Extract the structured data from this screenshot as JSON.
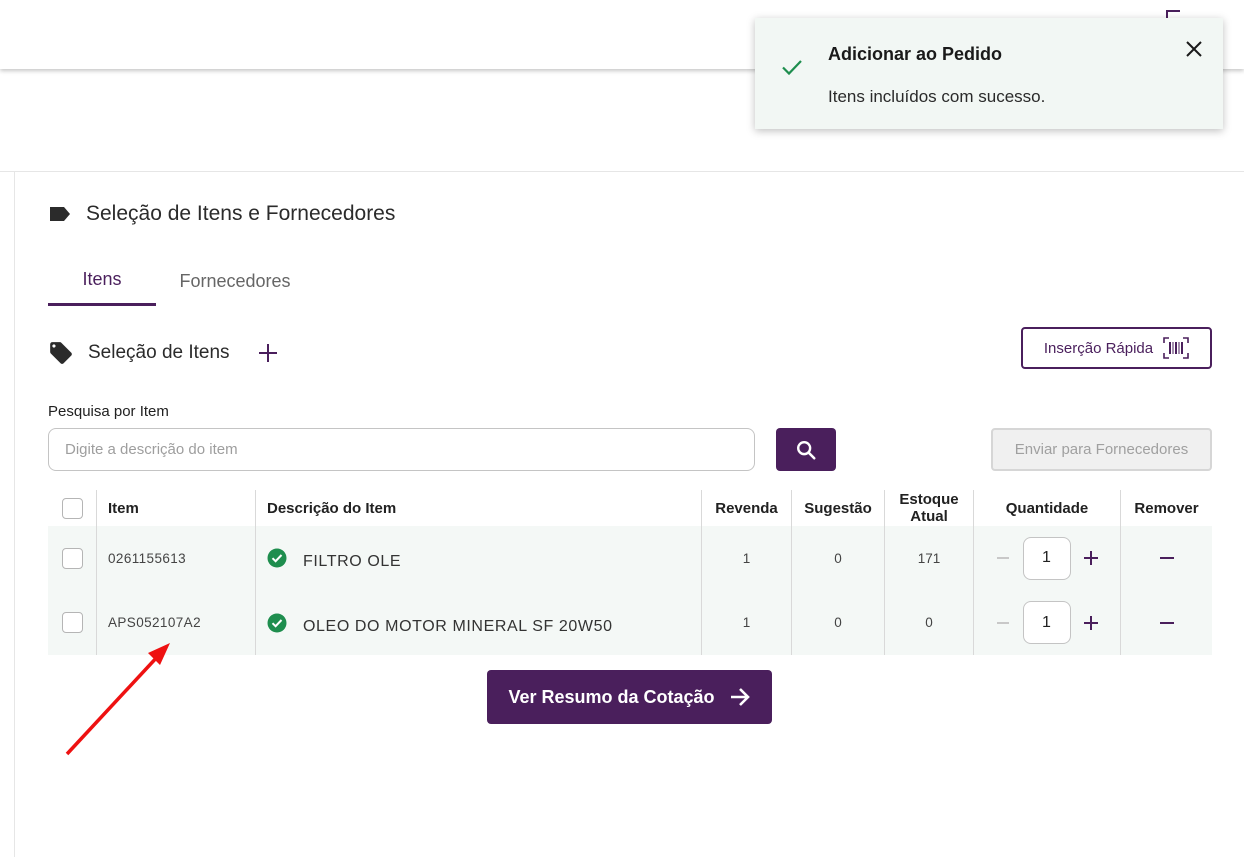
{
  "toast": {
    "title": "Adicionar ao Pedido",
    "message": "Itens incluídos com sucesso."
  },
  "section": {
    "title": "Seleção de Itens e Fornecedores"
  },
  "tabs": [
    {
      "label": "Itens",
      "active": true
    },
    {
      "label": "Fornecedores",
      "active": false
    }
  ],
  "items_section": {
    "title": "Seleção de Itens",
    "quick_insert_label": "Inserção Rápida"
  },
  "search": {
    "label": "Pesquisa por Item",
    "placeholder": "Digite a descrição do item",
    "value": ""
  },
  "send_button_label": "Enviar para Fornecedores",
  "table": {
    "headers": {
      "item": "Item",
      "description": "Descrição do Item",
      "resale": "Revenda",
      "suggestion": "Sugestão",
      "stock": "Estoque Atual",
      "quantity": "Quantidade",
      "remove": "Remover"
    },
    "rows": [
      {
        "code": "0261155613",
        "description": "FILTRO OLE",
        "resale": "1",
        "suggestion": "0",
        "stock": "171",
        "quantity": "1"
      },
      {
        "code": "APS052107A2",
        "description": "OLEO DO MOTOR MINERAL SF 20W50",
        "resale": "1",
        "suggestion": "0",
        "stock": "0",
        "quantity": "1"
      }
    ]
  },
  "summary_button_label": "Ver Resumo da Cotação",
  "colors": {
    "brand": "#4a1f5c",
    "success": "#1e8e4e",
    "annotation_arrow": "#ee1111"
  }
}
